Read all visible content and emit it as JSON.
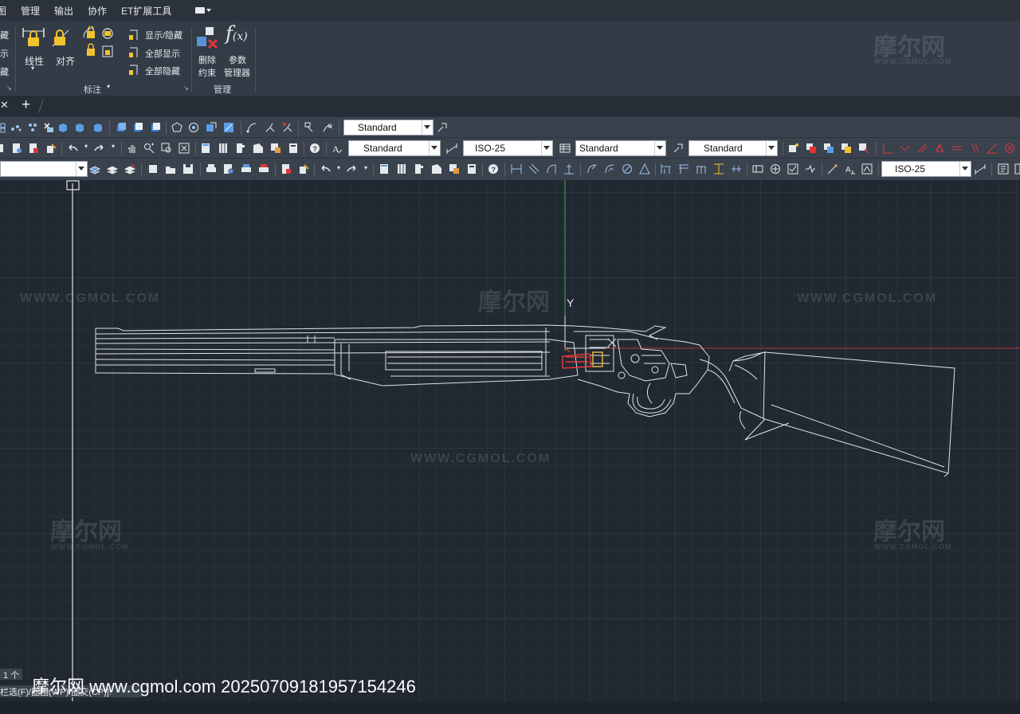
{
  "menubar": {
    "items": [
      "图",
      "管理",
      "输出",
      "协作",
      "ET扩展工具"
    ]
  },
  "ribbon": {
    "left_cut_labels": [
      "藏",
      "示",
      "藏"
    ],
    "annotation_panel": {
      "title": "标注",
      "linear_label": "线性",
      "align_label": "对齐",
      "show_hide_label": "显示/隐藏",
      "show_all_label": "全部显示",
      "hide_all_label": "全部隐藏"
    },
    "manage_panel": {
      "title": "管理",
      "delete_constraint_label": "删除\n约束",
      "delete_label_1": "删除",
      "delete_label_2": "约束",
      "params_label_1": "参数",
      "params_label_2": "管理器",
      "fx_label": "f(x)"
    }
  },
  "toolbar1": {
    "style_combo": "Standard"
  },
  "toolbar2": {
    "text_style_combo": "Standard",
    "dim_style_combo": "ISO-25",
    "table_style_combo": "Standard",
    "multileader_style_combo": "Standard"
  },
  "toolbar3": {
    "layer_combo": "",
    "dim_style_combo": "ISO-25"
  },
  "canvas": {
    "ucs_y_label": "Y",
    "watermarks": {
      "url": "WWW.CGMOL.COM",
      "logo": "摩尔网",
      "logo_sub": "WWW.CGMOL.COM"
    },
    "colors": {
      "background": "#212831",
      "drawing_lines": "#dfe3e8",
      "y_axis": "#3fae49",
      "x_axis": "#b73a3a",
      "highlight_red": "#e03a3a",
      "highlight_yellow": "#e0b43a"
    }
  },
  "command": {
    "count": "1 个",
    "prompt": "栏选(F)/圈围(WP)/圈交(CP)]:"
  },
  "footer": {
    "watermark_text": "摩尔网 www.cgmol.com 20250709181957154246"
  }
}
